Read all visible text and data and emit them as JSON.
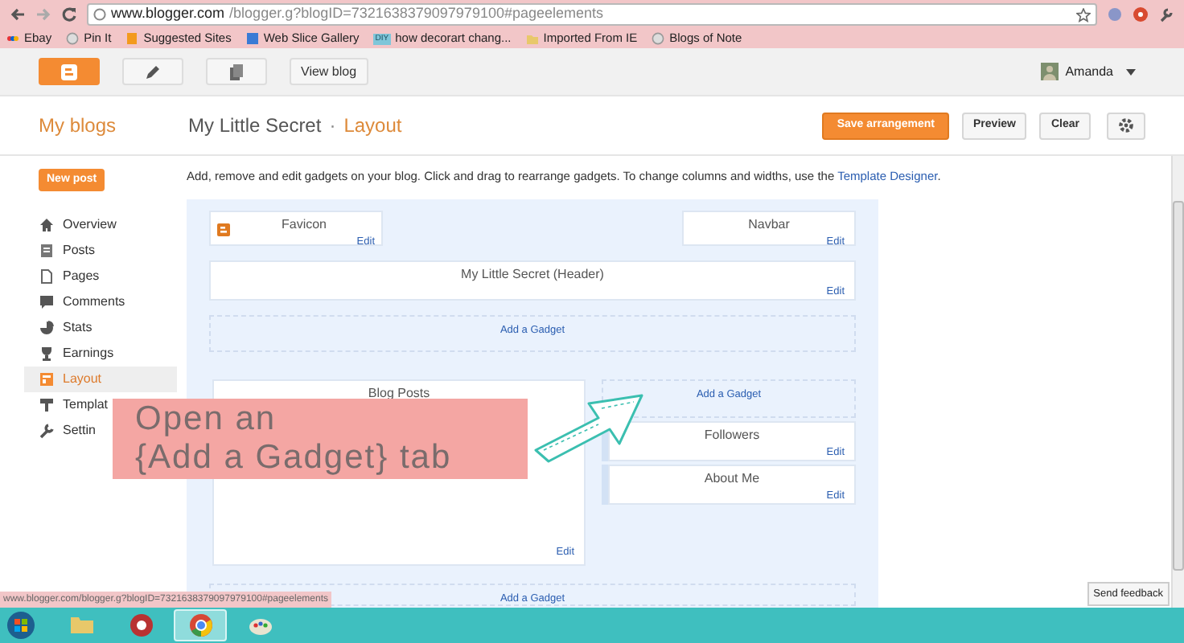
{
  "browser": {
    "url_host": "www.blogger.com",
    "url_path": "/blogger.g?blogID=7321638379097979100#pageelements",
    "bookmarks": [
      {
        "label": "Ebay",
        "kind": "ebay"
      },
      {
        "label": "Pin It",
        "kind": "page"
      },
      {
        "label": "Suggested Sites",
        "kind": "suggested"
      },
      {
        "label": "Web Slice Gallery",
        "kind": "slice"
      },
      {
        "label": "how decorart chang...",
        "kind": "diy",
        "badge": "DIY"
      },
      {
        "label": "Imported From IE",
        "kind": "folder"
      },
      {
        "label": "Blogs of Note",
        "kind": "page"
      }
    ]
  },
  "toolbar": {
    "view_blog": "View blog",
    "user": "Amanda"
  },
  "header": {
    "my_blogs": "My blogs",
    "blog_title": "My Little Secret",
    "separator": "·",
    "page": "Layout",
    "buttons": [
      {
        "label": "Save arrangement",
        "kind": "primary"
      },
      {
        "label": "Preview",
        "kind": "plain"
      },
      {
        "label": "Clear",
        "kind": "plain"
      }
    ]
  },
  "sidebar": {
    "new_post": "New post",
    "items": [
      {
        "label": "Overview",
        "kind": "home",
        "selected": false
      },
      {
        "label": "Posts",
        "kind": "posts",
        "selected": false
      },
      {
        "label": "Pages",
        "kind": "pages",
        "selected": false
      },
      {
        "label": "Comments",
        "kind": "comments",
        "selected": false
      },
      {
        "label": "Stats",
        "kind": "stats",
        "selected": false
      },
      {
        "label": "Earnings",
        "kind": "earnings",
        "selected": false
      },
      {
        "label": "Layout",
        "kind": "layout",
        "selected": true
      },
      {
        "label": "Templat",
        "kind": "template",
        "selected": false
      },
      {
        "label": "Settin",
        "kind": "settings",
        "selected": false
      }
    ]
  },
  "layout": {
    "intro": "Add, remove and edit gadgets on your blog. Click and drag to rearrange gadgets. To change columns and widths, use the",
    "intro_link": "Template Designer",
    "intro_end": ".",
    "favicon": {
      "title": "Favicon",
      "edit": "Edit"
    },
    "navbar": {
      "title": "Navbar",
      "edit": "Edit"
    },
    "header_gadget": {
      "title": "My Little Secret (Header)",
      "edit": "Edit"
    },
    "add_gadget_top": "Add a Gadget",
    "blog_posts": {
      "title": "Blog Posts",
      "edit": "Edit"
    },
    "side_add_gadget": "Add a Gadget",
    "side_gadgets": [
      {
        "title": "Followers",
        "edit": "Edit"
      },
      {
        "title": "About Me",
        "edit": "Edit"
      }
    ],
    "add_gadget_bottom": "Add a Gadget"
  },
  "annotation": {
    "lines": [
      "Open an",
      "{Add a Gadget} tab"
    ]
  },
  "status_url": "www.blogger.com/blogger.g?blogID=7321638379097979100#pageelements",
  "send_feedback": "Send feedback",
  "taskbar": {
    "apps": [
      {
        "kind": "folder",
        "selected": false
      },
      {
        "kind": "media",
        "selected": false
      },
      {
        "kind": "chrome",
        "selected": true
      },
      {
        "kind": "paint",
        "selected": false
      }
    ]
  }
}
